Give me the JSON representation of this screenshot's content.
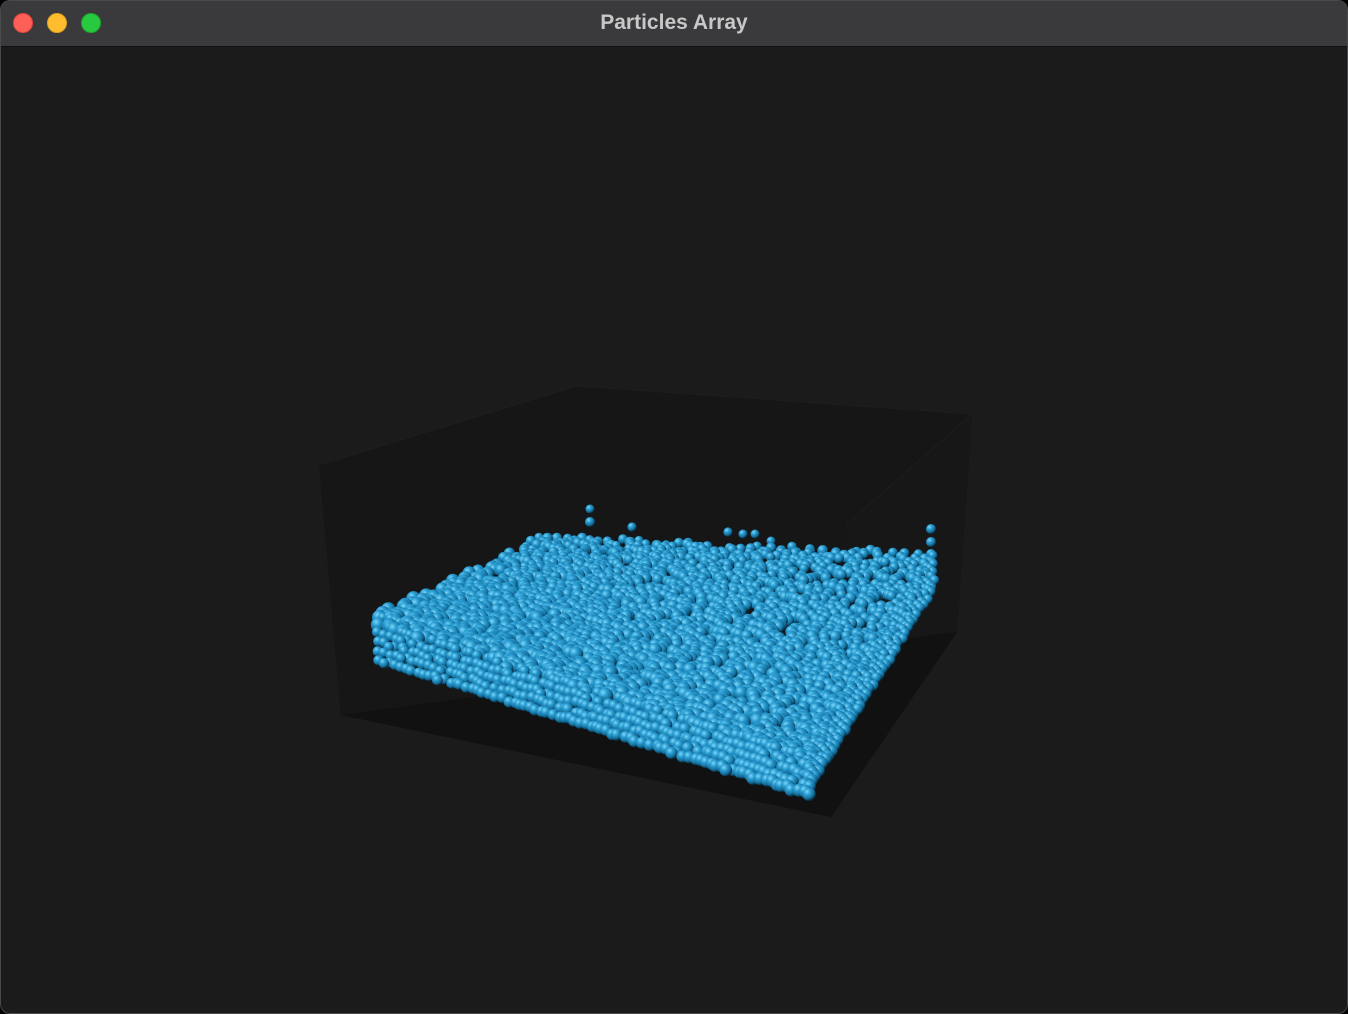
{
  "window": {
    "title": "Particles Array"
  },
  "controls": {
    "close_icon": "close-icon",
    "minimize_icon": "minimize-icon",
    "zoom_icon": "zoom-icon"
  },
  "scene": {
    "background_color": "#1b1b1b",
    "container_color": "#141414",
    "particle_color": "#1f8fc4",
    "particle_highlight": "#6fd0f5",
    "particle_shadow": "#0a3850"
  }
}
